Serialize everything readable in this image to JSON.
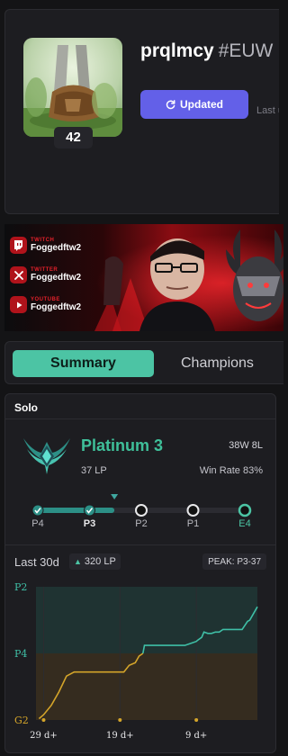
{
  "profile": {
    "summoner_name": "prqlmcy",
    "tag": "#EUW",
    "level": "42",
    "update_button": "Updated",
    "last_updated_text": "Last u"
  },
  "banner": {
    "socials": [
      {
        "platform": "TWITCH",
        "handle": "Foggedftw2",
        "icon": "twitch-icon"
      },
      {
        "platform": "TWITTER",
        "handle": "Foggedftw2",
        "icon": "x-twitter-icon"
      },
      {
        "platform": "YOUTUBE",
        "handle": "Foggedftw2",
        "icon": "youtube-icon"
      }
    ]
  },
  "tabs": [
    {
      "label": "Summary",
      "active": true
    },
    {
      "label": "Champions",
      "active": false
    }
  ],
  "ranked": {
    "queue_title": "Solo",
    "tier": "Platinum 3",
    "lp": "37 LP",
    "wins_losses": "38W 8L",
    "win_rate": "Win Rate 83%",
    "progress": {
      "steps": [
        "P4",
        "P3",
        "P2",
        "P1",
        "E4"
      ],
      "current_index": 1,
      "marker_fraction": 0.37
    },
    "last_30d_label": "Last 30d",
    "lp_gain": "320 LP",
    "peak": "PEAK: P3-37"
  },
  "colors": {
    "accent": "#4cc4a4",
    "update_button": "#6360e8",
    "tier_text": "#3fc09a",
    "gold_line": "#d4a52a",
    "teal_line": "#3fbfa6"
  },
  "chart_data": {
    "type": "line",
    "y_tick_labels": [
      "P2",
      "P4",
      "G2"
    ],
    "y_ticks": [
      1,
      0.5,
      0
    ],
    "x_tick_labels": [
      "29 d+",
      "19 d+",
      "9 d+"
    ],
    "x_ticks": [
      29,
      19,
      9
    ],
    "xlim": [
      30,
      1
    ],
    "ylim": [
      0,
      1
    ],
    "series": [
      {
        "x": [
          29.6,
          29,
          28,
          27,
          26,
          25,
          24,
          23,
          22,
          21,
          20,
          19,
          18.5,
          17.8,
          17,
          16.5,
          16,
          15.8,
          15,
          14,
          13,
          12,
          11,
          10.5,
          10,
          9,
          8.8,
          8.3,
          8,
          7.5,
          7,
          6.5,
          6,
          5.5,
          4.7,
          4,
          3,
          2.3,
          2,
          1
        ],
        "y": [
          0.01,
          0.04,
          0.11,
          0.21,
          0.33,
          0.36,
          0.36,
          0.36,
          0.36,
          0.36,
          0.36,
          0.36,
          0.36,
          0.41,
          0.43,
          0.48,
          0.5,
          0.56,
          0.56,
          0.56,
          0.56,
          0.56,
          0.56,
          0.56,
          0.57,
          0.59,
          0.6,
          0.62,
          0.66,
          0.65,
          0.65,
          0.66,
          0.66,
          0.68,
          0.68,
          0.68,
          0.68,
          0.74,
          0.75,
          0.85
        ]
      }
    ]
  }
}
